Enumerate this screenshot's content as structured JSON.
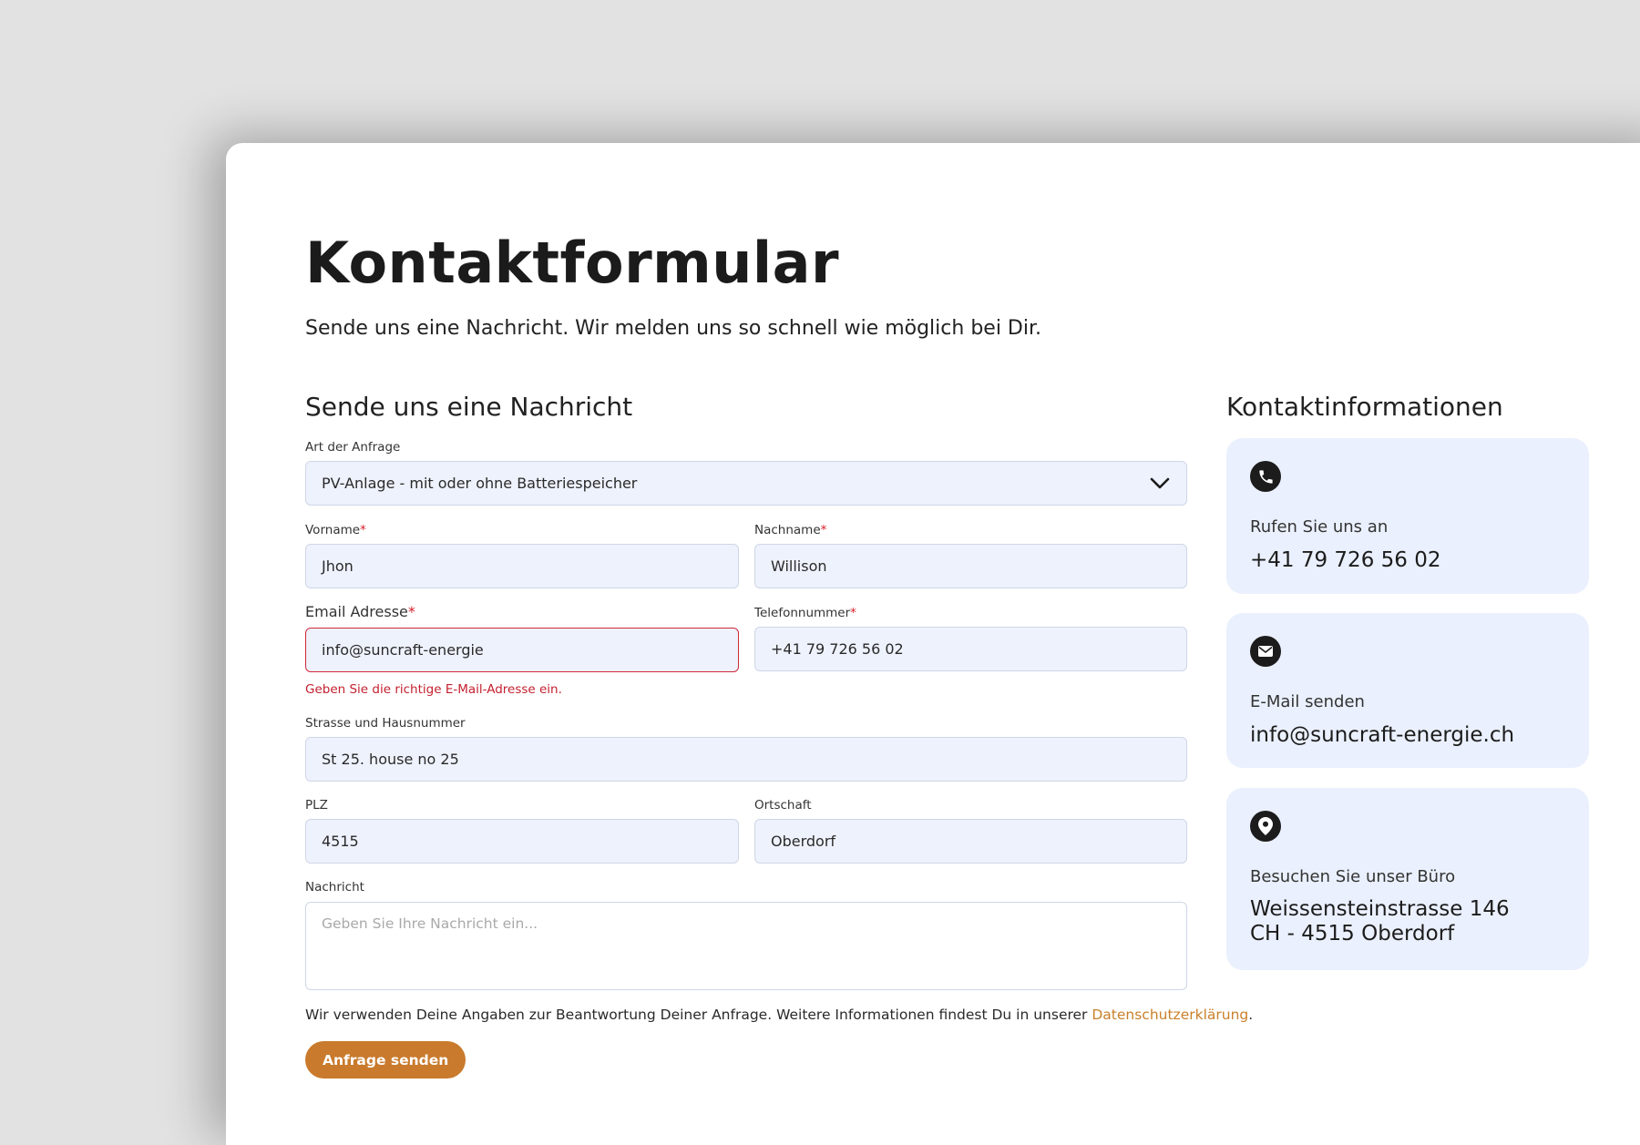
{
  "header": {
    "title": "Kontaktformular",
    "subtitle": "Sende uns eine Nachricht. Wir melden uns so schnell wie möglich bei Dir."
  },
  "form": {
    "section_title": "Sende uns eine Nachricht",
    "inquiry_type": {
      "label": "Art der Anfrage",
      "value": "PV-Anlage - mit oder ohne Batteriespeicher"
    },
    "first_name": {
      "label": "Vorname",
      "required_mark": "*",
      "value": "Jhon"
    },
    "last_name": {
      "label": "Nachname",
      "required_mark": "*",
      "value": "Willison"
    },
    "email": {
      "label": "Email Adresse",
      "required_mark": "*",
      "value": "info@suncraft-energie",
      "error": "Geben Sie die richtige E-Mail-Adresse ein."
    },
    "phone": {
      "label": "Telefonnummer",
      "required_mark": "*",
      "value": "+41 79 726 56 02"
    },
    "street": {
      "label": "Strasse und Hausnummer",
      "value": "St 25. house no 25"
    },
    "zip": {
      "label": "PLZ",
      "value": "4515"
    },
    "city": {
      "label": "Ortschaft",
      "value": "Oberdorf"
    },
    "message": {
      "label": "Nachricht",
      "placeholder": "Geben Sie Ihre Nachricht ein...",
      "value": ""
    },
    "privacy_text": "Wir verwenden Deine Angaben zur Beantwortung Deiner Anfrage. Weitere Informationen findest Du in unserer ",
    "privacy_link": "Datenschutzerklärung",
    "privacy_end": ".",
    "submit_label": "Anfrage senden"
  },
  "contact": {
    "section_title": "Kontaktinformationen",
    "phone": {
      "icon": "phone-icon",
      "label": "Rufen Sie uns an",
      "value": "+41 79 726 56 02"
    },
    "email": {
      "icon": "mail-icon",
      "label": "E-Mail senden",
      "value": "info@suncraft-energie.ch"
    },
    "office": {
      "icon": "location-pin-icon",
      "label": "Besuchen Sie unser Büro",
      "line1": "Weissensteinstrasse 146",
      "line2": "CH - 4515 Oberdorf"
    }
  },
  "colors": {
    "accent": "#c97a2c",
    "error": "#d0283a",
    "field_bg": "#eef2fd",
    "card_bg": "#eaf0fd"
  }
}
